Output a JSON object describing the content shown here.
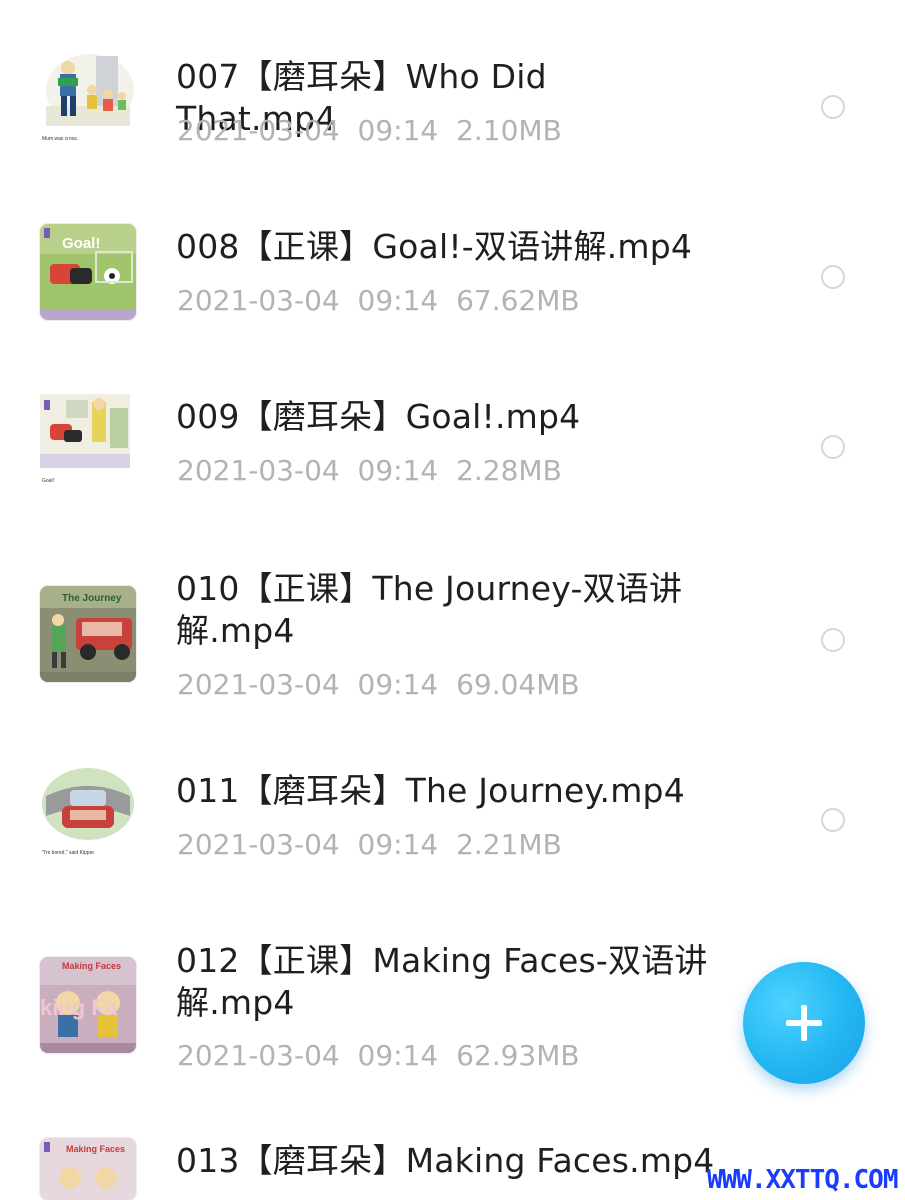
{
  "files": [
    {
      "name": "007【磨耳朵】Who Did That.mp4",
      "date": "2021-03-04",
      "time": "09:14",
      "size": "2.10MB",
      "thumbnail_icon": "book-page-thumbnail-icon",
      "thumbnail_caption": "Mum was cross."
    },
    {
      "name": "008【正课】Goal!-双语讲解.mp4",
      "date": "2021-03-04",
      "time": "09:14",
      "size": "67.62MB",
      "thumbnail_icon": "book-cover-thumbnail-icon",
      "thumbnail_title": "Goal!"
    },
    {
      "name": "009【磨耳朵】Goal!.mp4",
      "date": "2021-03-04",
      "time": "09:14",
      "size": "2.28MB",
      "thumbnail_icon": "book-page-thumbnail-icon",
      "thumbnail_caption": "Goal!"
    },
    {
      "name": "010【正课】The Journey-双语讲解.mp4",
      "date": "2021-03-04",
      "time": "09:14",
      "size": "69.04MB",
      "thumbnail_icon": "book-cover-thumbnail-icon",
      "thumbnail_title": "The Journey"
    },
    {
      "name": "011【磨耳朵】The Journey.mp4",
      "date": "2021-03-04",
      "time": "09:14",
      "size": "2.21MB",
      "thumbnail_icon": "book-page-thumbnail-icon",
      "thumbnail_caption": "\"I'm bored,\" said Kipper."
    },
    {
      "name": "012【正课】Making Faces-双语讲解.mp4",
      "date": "2021-03-04",
      "time": "09:14",
      "size": "62.93MB",
      "thumbnail_icon": "book-cover-thumbnail-icon",
      "thumbnail_title": "Making Faces",
      "thumbnail_overlay": "king Fa"
    },
    {
      "name": "013【磨耳朵】Making Faces.mp4",
      "date": "",
      "time": "",
      "size": "",
      "thumbnail_icon": "book-cover-thumbnail-icon",
      "thumbnail_title": "Making Faces"
    }
  ],
  "fab": {
    "icon": "plus-icon",
    "color": "#22b6f2"
  },
  "watermark": {
    "text": "WWW.XXTTQ.COM",
    "color": "#1a3cff"
  },
  "colors": {
    "title_text": "#1f1f1f",
    "meta_text": "#b3b3b3",
    "radio_border": "#d6d6d6"
  }
}
